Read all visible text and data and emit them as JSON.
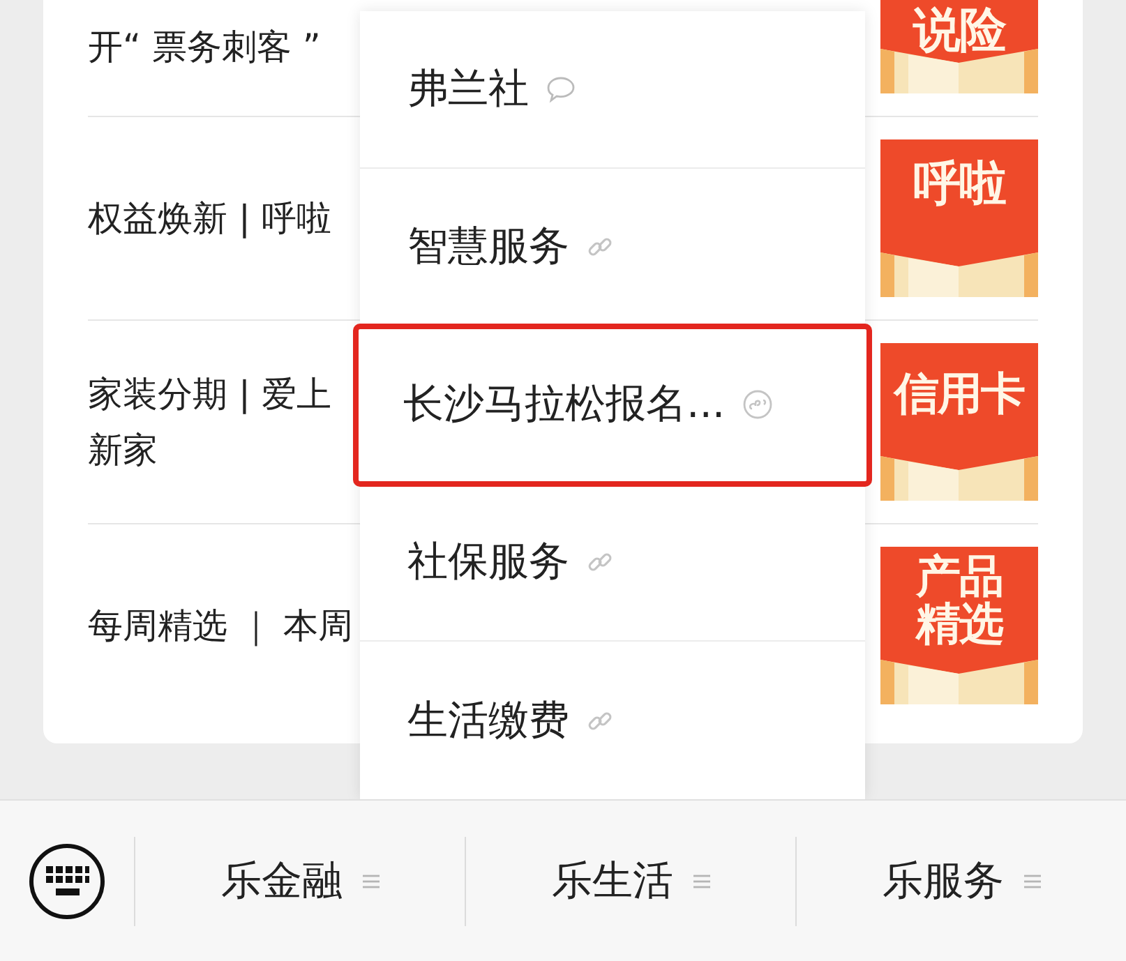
{
  "articles": [
    {
      "lines": [
        "开“ 票务刺客 ”"
      ],
      "thumbnail": "说险"
    },
    {
      "lines": [
        "权益焕新 | 呼啦"
      ],
      "thumbnail": "呼啦"
    },
    {
      "lines": [
        "家装分期 | 爱上",
        "新家"
      ],
      "thumbnail": "信用卡"
    },
    {
      "lines": [
        "每周精选 ｜ 本周"
      ],
      "thumbnail": "产品精选"
    }
  ],
  "popup_menu": {
    "items": [
      {
        "label": "弗兰社",
        "kind": "chat",
        "selected": false
      },
      {
        "label": "智慧服务",
        "kind": "link",
        "selected": false
      },
      {
        "label": "长沙马拉松报名...",
        "kind": "miniprogram",
        "selected": true
      },
      {
        "label": "社保服务",
        "kind": "link",
        "selected": false
      },
      {
        "label": "生活缴费",
        "kind": "link",
        "selected": false
      }
    ]
  },
  "bottom_bar": {
    "tabs": [
      {
        "label": "乐金融"
      },
      {
        "label": "乐生活"
      },
      {
        "label": "乐服务"
      }
    ]
  }
}
